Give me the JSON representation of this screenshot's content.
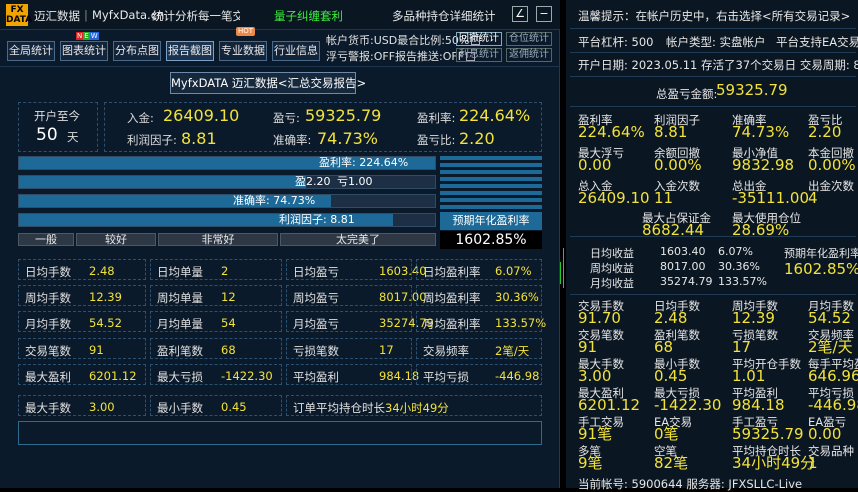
{
  "title": {
    "app": "迈汇数据",
    "domain": "MyfxData.cn",
    "slogan": "统计分析每一笔交易",
    "highlight": "量子纠缠套利",
    "subtitle": "多品种持仓详细统计"
  },
  "toolbar": {
    "b1": "全局统计",
    "b2": "图表统计",
    "b3": "分布点图",
    "b4": "报告截图",
    "b5": "专业数据",
    "b6": "行业信息",
    "new_badge": "NEW",
    "hot_badge": "HOT"
  },
  "options": {
    "currency": "帐户货币:USD最合比例:50%",
    "drawdown_warn": "浮亏警报:OFF报告推送:OFF",
    "btn_stats": "回撤统计",
    "btn_pos": "仓位统计",
    "btn_interest": "利息统计",
    "btn_repay": "返佣统计"
  },
  "report_title": "MyfxDATA 迈汇数据<汇总交易报告>",
  "summary": {
    "since_label": "开户至今",
    "days": "50",
    "days_unit": "天",
    "deposit_label": "入金:",
    "deposit": "26409.10",
    "profit_label": "盈亏:",
    "profit": "59325.79",
    "rate_label": "盈利率:",
    "rate": "224.64%",
    "factor_label": "利润因子:",
    "factor": "8.81",
    "win_label": "准确率:",
    "win": "74.73%",
    "ratio_label": "盈亏比:",
    "ratio": "2.20"
  },
  "bars": {
    "b1": "盈利率: 224.64%",
    "b2a": "盈2.20",
    "b2b": "亏1.00",
    "b3": "准确率: 74.73%",
    "b4": "利润因子: 8.81",
    "p1": 1.0,
    "p2": 0.69,
    "p3": 0.75,
    "p4": 0.9
  },
  "grades": [
    "一般",
    "较好",
    "非常好",
    "太完美了"
  ],
  "annual": {
    "label": "预期年化盈利率",
    "value": "1602.85%"
  },
  "cells": [
    {
      "k": "日均手数",
      "v": "2.48"
    },
    {
      "k": "日均单量",
      "v": "2"
    },
    {
      "k": "日均盈亏",
      "v": "1603.40"
    },
    {
      "k": "日均盈利率",
      "v": "6.07%"
    },
    {
      "k": "周均手数",
      "v": "12.39"
    },
    {
      "k": "周均单量",
      "v": "12"
    },
    {
      "k": "周均盈亏",
      "v": "8017.00"
    },
    {
      "k": "周均盈利率",
      "v": "30.36%"
    },
    {
      "k": "月均手数",
      "v": "54.52"
    },
    {
      "k": "月均单量",
      "v": "54"
    },
    {
      "k": "月均盈亏",
      "v": "35274.79"
    },
    {
      "k": "月均盈利率",
      "v": "133.57%"
    },
    {
      "k": "交易笔数",
      "v": "91"
    },
    {
      "k": "盈利笔数",
      "v": "68"
    },
    {
      "k": "亏损笔数",
      "v": "17"
    },
    {
      "k": "交易频率",
      "v": "2笔/天"
    },
    {
      "k": "最大盈利",
      "v": "6201.12"
    },
    {
      "k": "最大亏损",
      "v": "-1422.30"
    },
    {
      "k": "平均盈利",
      "v": "984.18"
    },
    {
      "k": "平均亏损",
      "v": "-446.98"
    },
    {
      "k": "最大手数",
      "v": "3.00"
    },
    {
      "k": "最小手数",
      "v": "0.45"
    }
  ],
  "hold": {
    "k": "订单平均持仓时长",
    "v": "34小时49分"
  },
  "right": {
    "tip": "温馨提示：在帐户历史中，右击选择<所有交易记录>",
    "lev": "平台杠杆:  500",
    "acct_type": "帐户类型:  实盘帐户",
    "ea": "平台支持EA交易",
    "open": "开户日期:  2023.05.11  存活了37个交易日  交易周期:  8周",
    "total_label": "总盈亏金额:",
    "total": "59325.79",
    "g1": [
      {
        "k": "盈利率",
        "v": "224.64%"
      },
      {
        "k": "利润因子",
        "v": "8.81"
      },
      {
        "k": "准确率",
        "v": "74.73%"
      },
      {
        "k": "盈亏比",
        "v": "2.20"
      }
    ],
    "g2": [
      {
        "k": "最大浮亏",
        "v": "0.00"
      },
      {
        "k": "余额回撤",
        "v": "0.00%"
      },
      {
        "k": "最小净值",
        "v": "9832.98"
      },
      {
        "k": "本金回撤",
        "v": "0.00%"
      }
    ],
    "g3": [
      {
        "k": "总入金",
        "v": "26409.10"
      },
      {
        "k": "入金次数",
        "v": "11"
      },
      {
        "k": "总出金",
        "v": "-35111.00"
      },
      {
        "k": "出金次数",
        "v": "4"
      }
    ],
    "g4": [
      {
        "k": "最大占保证金",
        "v": "8682.44"
      },
      {
        "k": "最大使用仓位",
        "v": "28.69%"
      }
    ],
    "inc": [
      {
        "k": "日均收益",
        "a": "1603.40",
        "b": "6.07%"
      },
      {
        "k": "周均收益",
        "a": "8017.00",
        "b": "30.36%"
      },
      {
        "k": "月均收益",
        "a": "35274.79",
        "b": "133.57%"
      }
    ],
    "annual_label": "预期年化盈利率",
    "annual": "1602.85%",
    "g5": [
      {
        "k": "交易手数",
        "v": "91.70"
      },
      {
        "k": "日均手数",
        "v": "2.48"
      },
      {
        "k": "周均手数",
        "v": "12.39"
      },
      {
        "k": "月均手数",
        "v": "54.52"
      }
    ],
    "g6": [
      {
        "k": "交易笔数",
        "v": "91"
      },
      {
        "k": "盈利笔数",
        "v": "68"
      },
      {
        "k": "亏损笔数",
        "v": "17"
      },
      {
        "k": "交易频率",
        "v": "2笔/天"
      }
    ],
    "g7": [
      {
        "k": "最大手数",
        "v": "3.00"
      },
      {
        "k": "最小手数",
        "v": "0.45"
      },
      {
        "k": "平均开仓手数",
        "v": "1.01"
      },
      {
        "k": "每手平均盈",
        "v": "646.96"
      }
    ],
    "g8": [
      {
        "k": "最大盈利",
        "v": "6201.12"
      },
      {
        "k": "最大亏损",
        "v": "-1422.30"
      },
      {
        "k": "平均盈利",
        "v": "984.18"
      },
      {
        "k": "平均亏损",
        "v": "-446.98"
      }
    ],
    "g9": [
      {
        "k": "手工交易",
        "v": "91笔"
      },
      {
        "k": "EA交易",
        "v": "0笔"
      },
      {
        "k": "手工盈亏",
        "v": "59325.79"
      },
      {
        "k": "EA盈亏",
        "v": "0.00"
      }
    ],
    "g10": [
      {
        "k": "多笔",
        "v": "9笔"
      },
      {
        "k": "空笔",
        "v": "82笔"
      },
      {
        "k": "平均持仓时长",
        "v": "34小时49分"
      },
      {
        "k": "交易品种",
        "v": "1"
      }
    ],
    "footer": "当前帐号:  5900644  服务器:  JFXSLLC-Live"
  }
}
